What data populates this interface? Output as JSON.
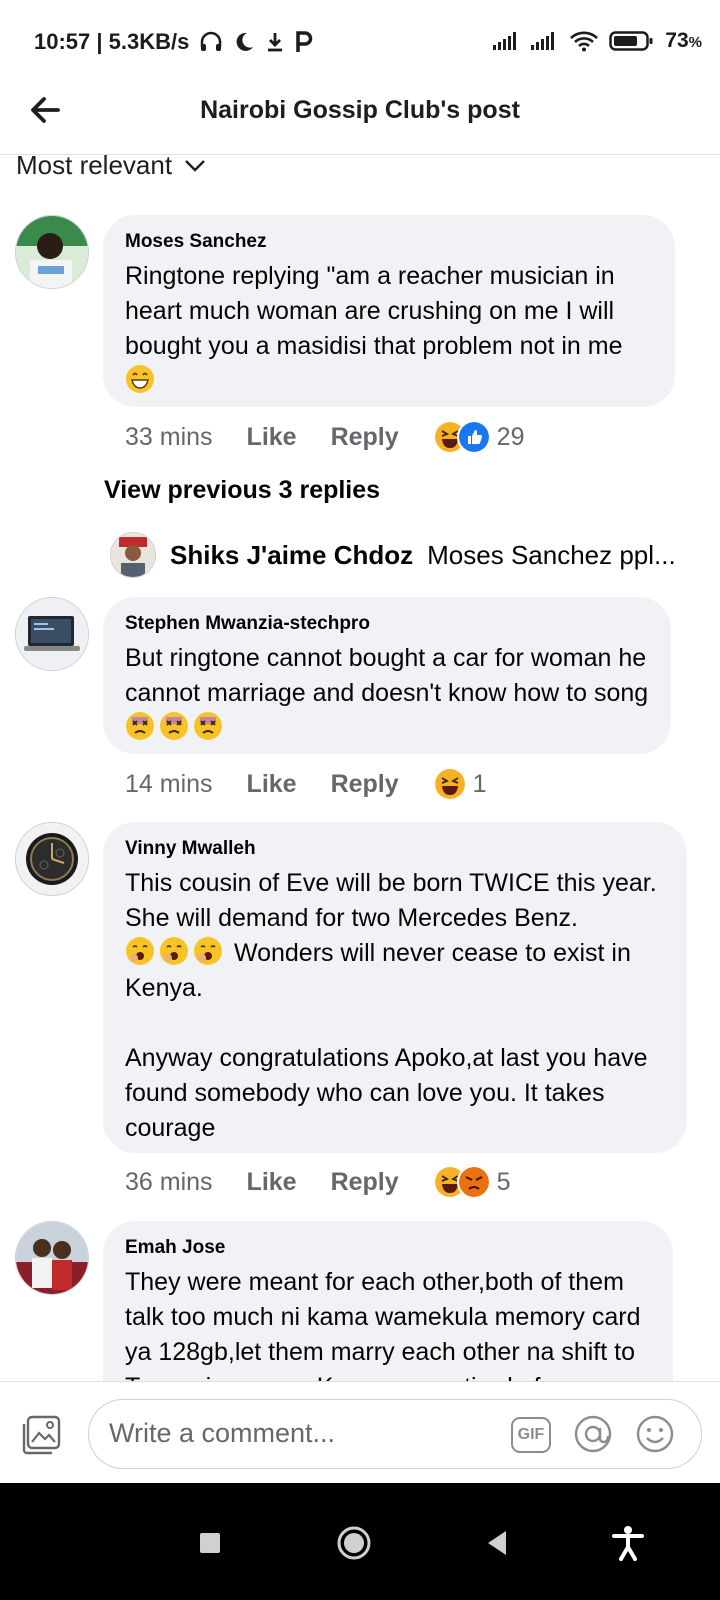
{
  "status": {
    "time": "10:57",
    "speed": "5.3KB/s",
    "battery": "73",
    "battery_unit": "%",
    "icons": [
      "headphones-icon",
      "moon-icon",
      "download-icon",
      "p-icon",
      "signal-icon",
      "signal-icon",
      "wifi-icon",
      "battery-icon"
    ]
  },
  "header": {
    "title": "Nairobi Gossip Club's post"
  },
  "sort": {
    "label": "Most relevant"
  },
  "comments": [
    {
      "author": "Moses Sanchez",
      "text": "Ringtone replying \"am a reacher musician in heart much woman are crushing on me I will bought you a masidisi that problem not in me",
      "time": "33 mins",
      "like": "Like",
      "reply": "Reply",
      "reaction_count": "29"
    },
    {
      "author": "Stephen Mwanzia-stechpro",
      "text": "But ringtone cannot bought a car for woman he cannot marriage and doesn't know how to song",
      "time": "14 mins",
      "like": "Like",
      "reply": "Reply",
      "reaction_count": "1"
    },
    {
      "author": "Vinny Mwalleh",
      "text_a": "This cousin of Eve will be born TWICE this year. She will demand for two Mercedes Benz.",
      "text_b": "Wonders will never cease to exist in Kenya.",
      "text_c": "Anyway congratulations Apoko,at last you have found somebody who can love you. It takes courage",
      "time": "36 mins",
      "like": "Like",
      "reply": "Reply",
      "reaction_count": "5"
    },
    {
      "author": "Emah Jose",
      "text": "They were meant for each other,both of them talk too much ni kama wamekula memory card ya 128gb,let them marry each other na shift to Tanzania coz we Kenyans are tired of"
    }
  ],
  "replies": {
    "view_previous": "View previous 3 replies",
    "latest_author": "Shiks J'aime Chdoz",
    "latest_preview": "Moses Sanchez ppl..."
  },
  "composer": {
    "placeholder": "Write a comment...",
    "gif": "GIF"
  },
  "colors": {
    "bubble": "#f0f2f5",
    "meta": "#65676b",
    "like_blue": "#1877f2",
    "haha_yellow": "#f7b125"
  }
}
